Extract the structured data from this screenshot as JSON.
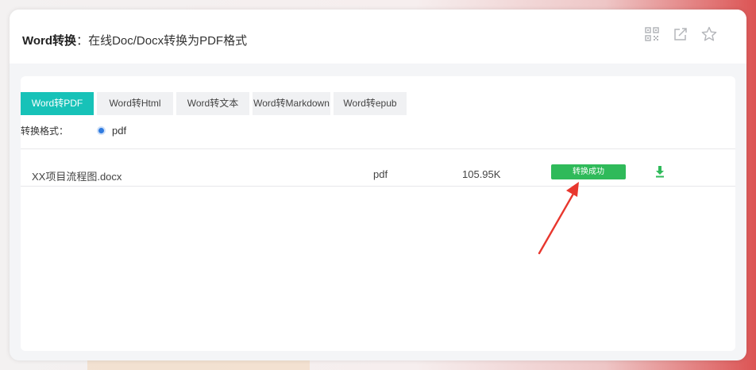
{
  "header": {
    "title_bold": "Word转换",
    "title_rest": "：在线Doc/Docx转换为PDF格式",
    "icons": [
      "qrcode-icon",
      "share-icon",
      "star-icon"
    ]
  },
  "tabs": [
    {
      "label": "Word转PDF",
      "active": true
    },
    {
      "label": "Word转Html",
      "active": false
    },
    {
      "label": "Word转文本",
      "active": false
    },
    {
      "label": "Word转Markdown",
      "active": false
    },
    {
      "label": "Word转epub",
      "active": false
    }
  ],
  "format": {
    "label": "转换格式：",
    "option": "pdf",
    "selected": true
  },
  "files": [
    {
      "name": "XX项目流程图.docx",
      "type": "pdf",
      "size": "105.95K",
      "status": "转换成功"
    }
  ],
  "colors": {
    "accent": "#17c2b8",
    "success": "#2fba5a",
    "annotation": "#e8372e"
  }
}
